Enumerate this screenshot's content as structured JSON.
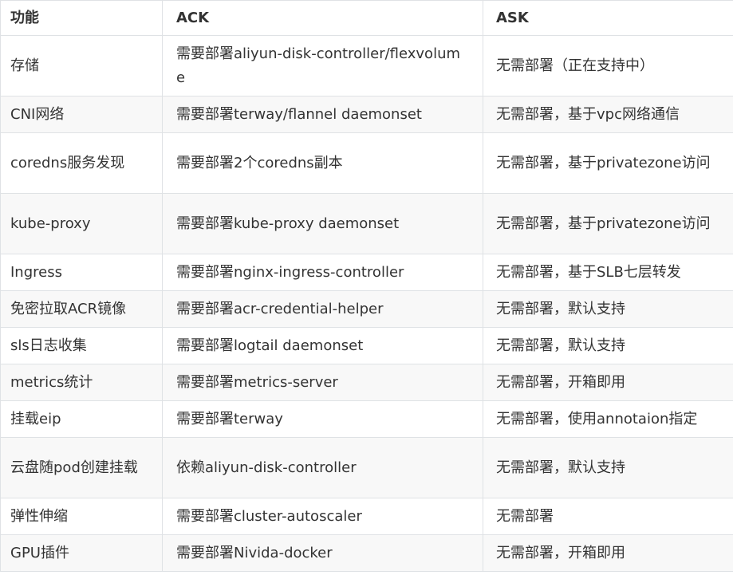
{
  "table": {
    "headers": [
      "功能",
      "ACK",
      "ASK"
    ],
    "rows": [
      [
        "存储",
        "需要部署aliyun-disk-controller/flexvolume",
        "无需部署（正在支持中）"
      ],
      [
        "CNI网络",
        "需要部署terway/flannel daemonset",
        "无需部署，基于vpc网络通信"
      ],
      [
        "coredns服务发现",
        "需要部署2个coredns副本",
        "无需部署，基于privatezone访问"
      ],
      [
        "kube-proxy",
        "需要部署kube-proxy daemonset",
        "无需部署，基于privatezone访问"
      ],
      [
        "Ingress",
        "需要部署nginx-ingress-controller",
        "无需部署，基于SLB七层转发"
      ],
      [
        "免密拉取ACR镜像",
        "需要部署acr-credential-helper",
        "无需部署，默认支持"
      ],
      [
        "sls日志收集",
        "需要部署logtail daemonset",
        "无需部署，默认支持"
      ],
      [
        "metrics统计",
        "需要部署metrics-server",
        "无需部署，开箱即用"
      ],
      [
        "挂载eip",
        "需要部署terway",
        "无需部署，使用annotaion指定"
      ],
      [
        "云盘随pod创建挂载",
        "依赖aliyun-disk-controller",
        "无需部署，默认支持"
      ],
      [
        "弹性伸缩",
        "需要部署cluster-autoscaler",
        "无需部署"
      ],
      [
        "GPU插件",
        "需要部署Nivida-docker",
        "无需部署，开箱即用"
      ]
    ]
  }
}
